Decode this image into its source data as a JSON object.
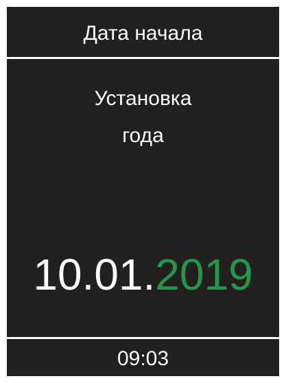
{
  "header": {
    "title": "Дата начала"
  },
  "prompt": {
    "line1": "Установка",
    "line2": "года"
  },
  "date": {
    "day_month": "10.01.",
    "year": "2019"
  },
  "footer": {
    "time": "09:03"
  },
  "colors": {
    "background": "#221f1f",
    "text": "#ffffff",
    "active_field": "#1f9a4a"
  }
}
